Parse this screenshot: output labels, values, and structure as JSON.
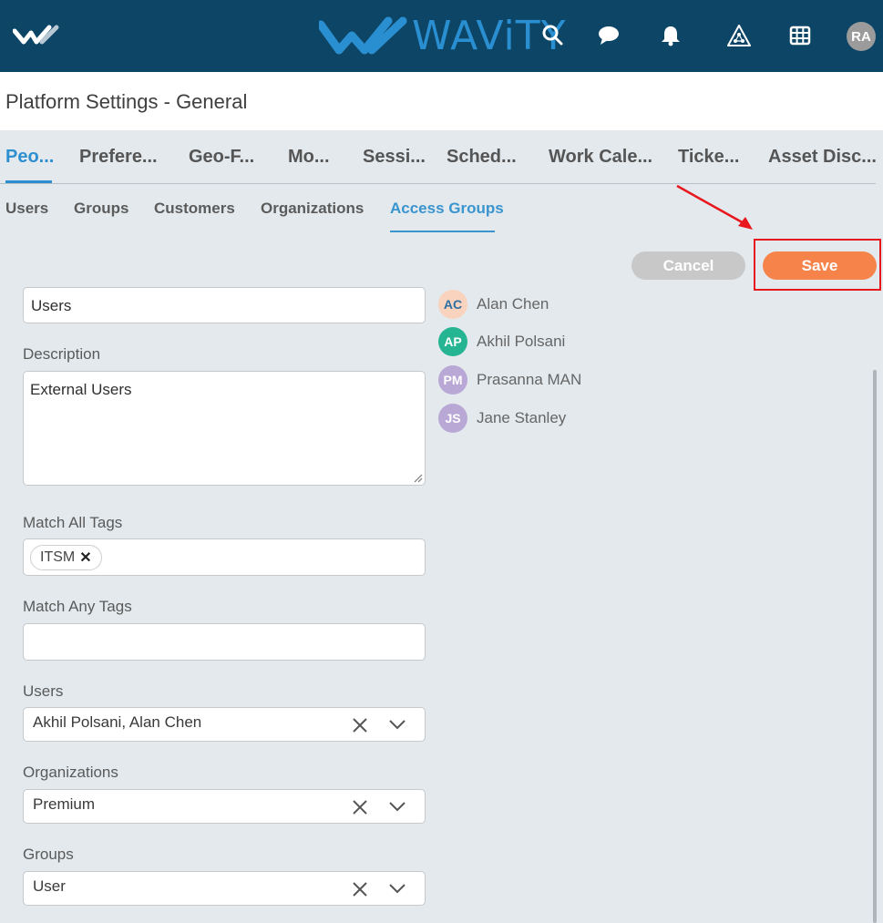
{
  "header": {
    "brand": "WAViTY",
    "avatar_initials": "RA"
  },
  "page": {
    "title": "Platform Settings - General"
  },
  "main_tabs": [
    {
      "label": "Peo..."
    },
    {
      "label": "Prefere..."
    },
    {
      "label": "Geo-F..."
    },
    {
      "label": "Mo..."
    },
    {
      "label": "Sessi..."
    },
    {
      "label": "Sched..."
    },
    {
      "label": "Work Cale..."
    },
    {
      "label": "Ticke..."
    },
    {
      "label": "Asset Disc..."
    }
  ],
  "sub_tabs": [
    {
      "label": "Users"
    },
    {
      "label": "Groups"
    },
    {
      "label": "Customers"
    },
    {
      "label": "Organizations"
    },
    {
      "label": "Access Groups"
    }
  ],
  "actions": {
    "cancel_label": "Cancel",
    "save_label": "Save"
  },
  "form": {
    "name_value": "Users",
    "description_label": "Description",
    "description_value": "External Users",
    "match_all_tags_label": "Match All Tags",
    "match_all_tags": [
      "ITSM"
    ],
    "match_any_tags_label": "Match Any Tags",
    "users_label": "Users",
    "users_value": "Akhil Polsani, Alan Chen",
    "organizations_label": "Organizations",
    "organizations_value": "Premium",
    "groups_label": "Groups",
    "groups_value": "User"
  },
  "members": [
    {
      "initials": "AC",
      "name": "Alan Chen",
      "color": "#f9d3bd",
      "text_color": "#2d6fa3"
    },
    {
      "initials": "AP",
      "name": "Akhil Polsani",
      "color": "#26b592",
      "text_color": "#ffffff"
    },
    {
      "initials": "PM",
      "name": "Prasanna MAN",
      "color": "#b9a7d5",
      "text_color": "#ffffff"
    },
    {
      "initials": "JS",
      "name": "Jane Stanley",
      "color": "#b9a7d5",
      "text_color": "#ffffff"
    }
  ],
  "colors": {
    "header_bg": "#0d4566",
    "accent": "#2d8fd0",
    "save": "#f6844a",
    "cancel": "#c8c8c8",
    "highlight": "#e8161d"
  }
}
